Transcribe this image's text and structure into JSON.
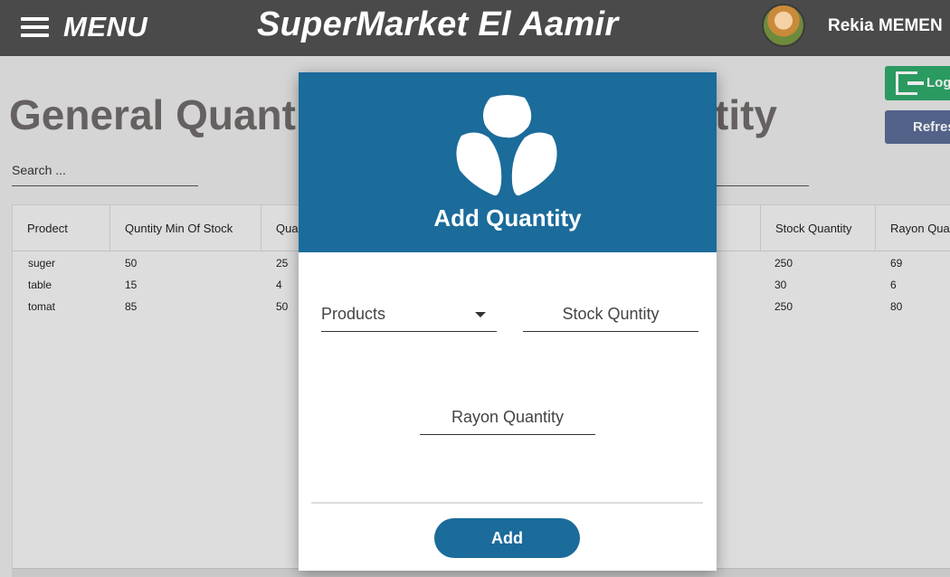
{
  "header": {
    "menu_label": "MENU",
    "app_title": "SuperMarket El Aamir",
    "user_name": "Rekia MEMEN"
  },
  "page": {
    "title_left": "General Quanti",
    "title_right": "tity",
    "search_placeholder": "Search ...",
    "logout_label": "Log",
    "refresh_label": "Refres"
  },
  "table": {
    "columns": [
      "Prodect",
      "Quntity Min Of Stock",
      "Qua",
      "Stock Quantity",
      "Rayon Qua"
    ],
    "rows": [
      {
        "product": "suger",
        "min_stock": "50",
        "qua": "25",
        "stock": "250",
        "rayon": "69"
      },
      {
        "product": "table",
        "min_stock": "15",
        "qua": "4",
        "stock": "30",
        "rayon": "6"
      },
      {
        "product": "tomat",
        "min_stock": "85",
        "qua": "50",
        "stock": "250",
        "rayon": "80"
      }
    ]
  },
  "modal": {
    "title": "Add Quantity",
    "products_label": "Products",
    "stock_label": "Stock Quntity",
    "rayon_label": "Rayon Quantity",
    "add_label": "Add"
  },
  "colors": {
    "topbar": "#4a4a4a",
    "modal_header": "#1b6b9b",
    "logout_green": "#2fa86a",
    "refresh_blue": "#5a6b95"
  }
}
